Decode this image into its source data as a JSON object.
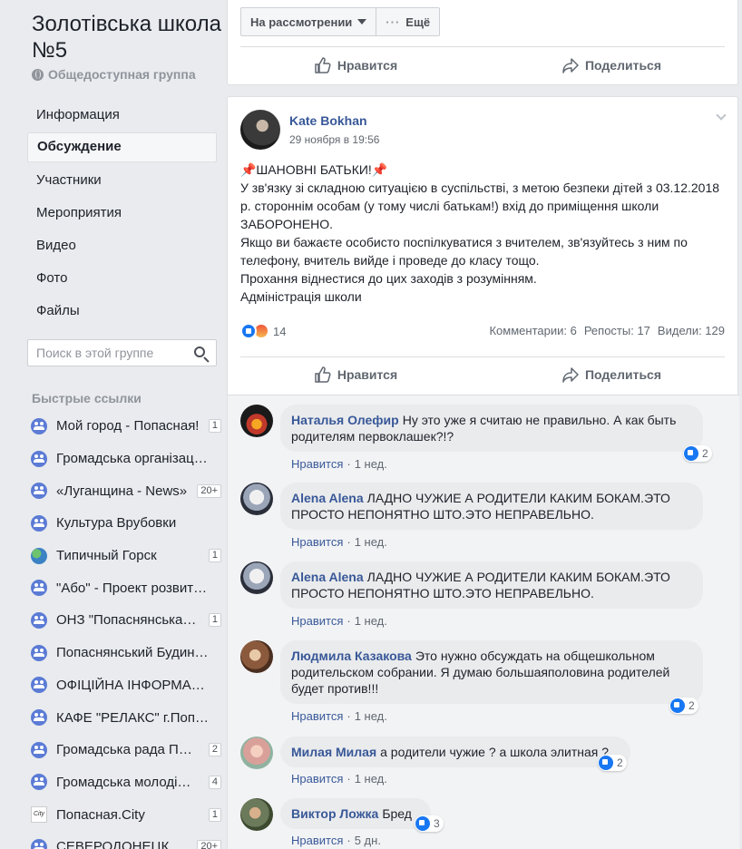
{
  "group": {
    "title": "Золотівська школа №5",
    "type": "Общедоступная группа"
  },
  "nav": {
    "items": [
      {
        "label": "Информация"
      },
      {
        "label": "Обсуждение"
      },
      {
        "label": "Участники"
      },
      {
        "label": "Мероприятия"
      },
      {
        "label": "Видео"
      },
      {
        "label": "Фото"
      },
      {
        "label": "Файлы"
      }
    ],
    "active": "Обсуждение"
  },
  "search": {
    "placeholder": "Поиск в этой группе"
  },
  "quick_links": {
    "header": "Быстрые ссылки",
    "items": [
      {
        "label": "Мой город - Попасная!",
        "badge": "1",
        "icon": "group-icon"
      },
      {
        "label": "Громадська організаці…",
        "badge": "",
        "icon": "group-icon"
      },
      {
        "label": "«Луганщина - News»",
        "badge": "20+",
        "icon": "group-icon"
      },
      {
        "label": "Культура Врубовки",
        "badge": "",
        "icon": "group-icon"
      },
      {
        "label": "Типичный Горск",
        "badge": "1",
        "icon": "earth-icon"
      },
      {
        "label": "\"Або\" - Проект розвитк…",
        "badge": "",
        "icon": "group-icon"
      },
      {
        "label": "ОНЗ \"Попаснянська…",
        "badge": "1",
        "icon": "group-icon"
      },
      {
        "label": "Попаснянський Будин…",
        "badge": "",
        "icon": "group-icon"
      },
      {
        "label": "ОФІЦІЙНА ІНФОРМАЦ…",
        "badge": "",
        "icon": "group-icon"
      },
      {
        "label": "КАФЕ \"РЕЛАКС\" г.Поп…",
        "badge": "",
        "icon": "group-icon"
      },
      {
        "label": "Громадська рада П…",
        "badge": "2",
        "icon": "group-icon"
      },
      {
        "label": "Громадська молоді…",
        "badge": "4",
        "icon": "group-icon"
      },
      {
        "label": "Попасная.City",
        "badge": "1",
        "icon": "city-icon"
      },
      {
        "label": "СЕВЕРОДОНЕЦК…",
        "badge": "20+",
        "icon": "group-icon"
      }
    ]
  },
  "topbar": {
    "status_label": "На рассмотрении",
    "more_label": "Ещё"
  },
  "actions": {
    "like_label": "Нравится",
    "share_label": "Поделиться"
  },
  "post": {
    "author": "Kate Bokhan",
    "time": "29 ноября в 19:56",
    "text": "📌ШАНОВНІ БАТЬКИ!📌\nУ зв'язку зі складною ситуацією в суспільстві, з метою безпеки дітей з 03.12.2018 р. стороннім особам (у тому числі батькам!) вхід до приміщення школи ЗАБОРОНЕНО.\nЯкщо ви бажаєте особисто поспілкуватися з вчителем, зв'язуйтесь з ним по телефону, вчитель вийде і проведе до класу тощо.\nПрохання віднестися до цих заходів з розумінням.\nАдміністрація школи",
    "reaction_count": "14",
    "comments": "Комментарии: 6",
    "reposts": "Репосты: 17",
    "views": "Видели: 129"
  },
  "comments": [
    {
      "name": "Наталья Олефир",
      "text": "Ну это уже я считаю не правильно. А как быть родителям первоклашек?!?",
      "like": "Нравится",
      "time": "1 нед.",
      "reactions": "2"
    },
    {
      "name": "Alena Alena",
      "text": "ЛАДНО ЧУЖИЕ А РОДИТЕЛИ КАКИМ БОКАМ.ЭТО ПРОСТО НЕПОНЯТНО ШТО.ЭТО НЕПРАВЕЛЬНО.",
      "like": "Нравится",
      "time": "1 нед.",
      "reactions": ""
    },
    {
      "name": "Alena Alena",
      "text": "ЛАДНО ЧУЖИЕ А РОДИТЕЛИ КАКИМ БОКАМ.ЭТО ПРОСТО НЕПОНЯТНО ШТО.ЭТО НЕПРАВЕЛЬНО.",
      "like": "Нравится",
      "time": "1 нед.",
      "reactions": ""
    },
    {
      "name": "Людмила Казакова",
      "text": "Это нужно обсуждать на общешкольном родительском собрании. Я думаю большаяполовина родителей будет против!!!",
      "like": "Нравится",
      "time": "1 нед.",
      "reactions": "2"
    },
    {
      "name": "Милая Милая",
      "text": "а родители чужие ? а школа элитная ?",
      "like": "Нравится",
      "time": "1 нед.",
      "reactions": "2"
    },
    {
      "name": "Виктор Ложка",
      "text": "Бред",
      "like": "Нравится",
      "time": "5 дн.",
      "reactions": "3"
    }
  ],
  "colors": {
    "link": "#385898",
    "like_blue": "#1877f2",
    "background": "#e9ebee"
  }
}
